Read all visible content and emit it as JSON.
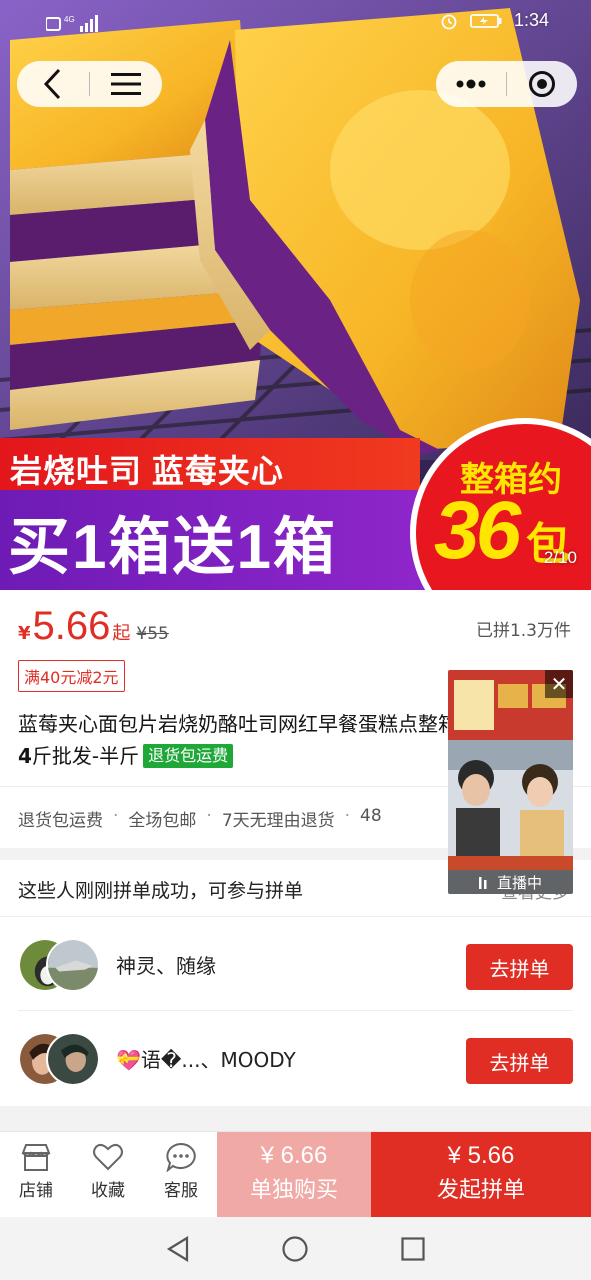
{
  "status_bar": {
    "network": "4G",
    "time": "1:34"
  },
  "hero": {
    "banner_line1": "岩烧吐司 蓝莓夹心",
    "banner_line2": "买1箱送1箱",
    "badge_top": "整箱约",
    "badge_number": "36",
    "badge_unit": "包",
    "page_indicator": "2/10"
  },
  "product": {
    "currency": "¥",
    "price": "5.66",
    "price_suffix": "起",
    "original_price": "¥55",
    "sold_count": "已拼1.3万件",
    "coupon": "满40元减2元",
    "title_part1": "蓝莓夹心面包片岩烧奶酪吐司网红早餐蛋糕",
    "title_part2": "点整箱",
    "title_bold": "4",
    "title_part3": "斤批发-半斤",
    "title_tag": "退货包运费",
    "services": [
      "退货包运费",
      "全场包邮",
      "7天无理由退货",
      "48"
    ]
  },
  "group_buy": {
    "header": "这些人刚刚拼单成功，可参与拼单",
    "more": "查看更多",
    "rows": [
      {
        "names": "神灵、随缘",
        "button": "去拼单"
      },
      {
        "names": "💝语�...、MOODY",
        "button": "去拼单"
      }
    ]
  },
  "live_popup": {
    "label": "直播中"
  },
  "action_bar": {
    "shop": "店铺",
    "favorite": "收藏",
    "service": "客服",
    "alone_price": "¥ 6.66",
    "alone_label": "单独购买",
    "group_price": "¥ 5.66",
    "group_label": "发起拼单"
  },
  "colors": {
    "accent_red": "#e02e24",
    "tag_green": "#1fa838",
    "buy_alone_bg": "#f0a9a5"
  }
}
